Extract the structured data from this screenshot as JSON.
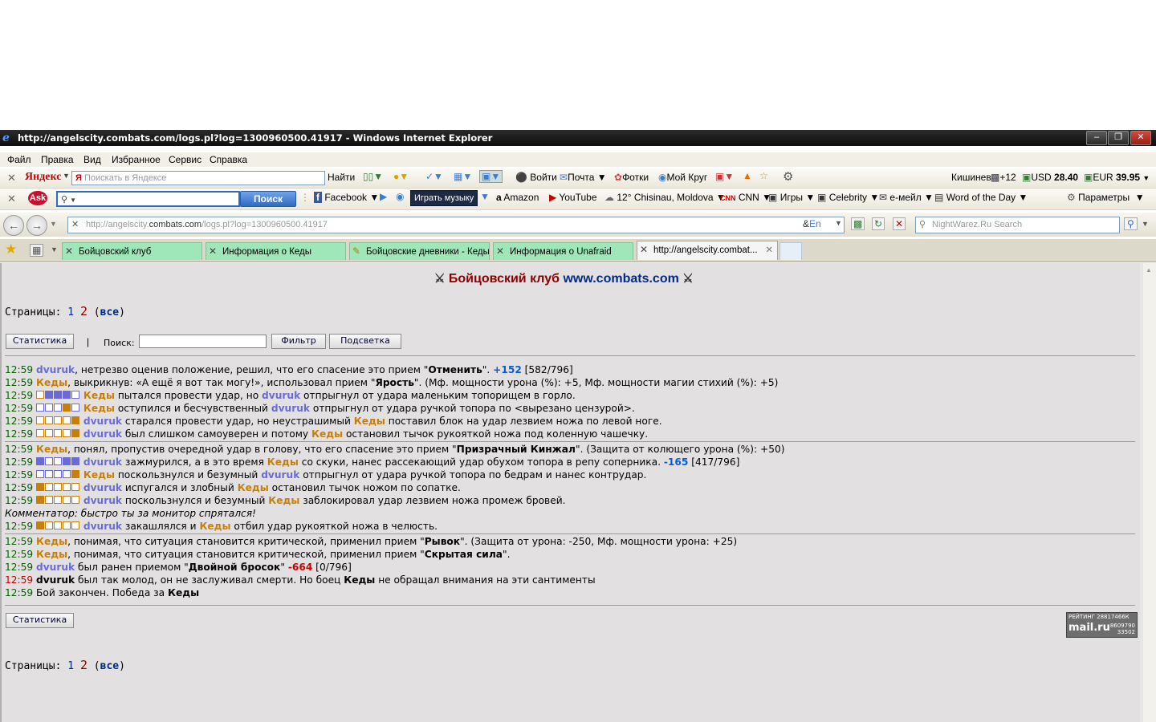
{
  "window": {
    "title": "http://angelscity.combats.com/logs.pl?log=1300960500.41917 - Windows Internet Explorer"
  },
  "menu": [
    "Файл",
    "Правка",
    "Вид",
    "Избранное",
    "Сервис",
    "Справка"
  ],
  "yandex": {
    "logo": "Яндекс",
    "search_placeholder": "Поискать в Яндексе",
    "find": "Найти",
    "login": "Войти",
    "mail": "Почта",
    "photos": "Фотки",
    "circle": "Мой Круг",
    "city": "Кишинев",
    "temp": "+12",
    "usd_label": "USD",
    "usd": "28.40",
    "eur_label": "EUR",
    "eur": "39.95"
  },
  "ask": {
    "logo": "Ask",
    "search": "Поиск",
    "facebook": "Facebook",
    "music": "Играть музыку",
    "amazon": "Amazon",
    "youtube": "YouTube",
    "weather": "12° Chisinau, Moldova",
    "cnn": "CNN",
    "games": "Игры",
    "celebrity": "Celebrity",
    "email": "e-мейл",
    "word": "Word of the Day",
    "params": "Параметры"
  },
  "address": {
    "prefix": "http://angelscity.",
    "domain": "combats.com",
    "path": "/logs.pl?log=1300960500.41917",
    "search_placeholder": "NightWarez.Ru Search"
  },
  "tabs": [
    {
      "label": "Бойцовский клуб"
    },
    {
      "label": "Информация о Кеды"
    },
    {
      "label": "Бойцовские дневники - Кеды"
    },
    {
      "label": "Информация о Unafraid"
    },
    {
      "label": "http://angelscity.combat..."
    }
  ],
  "page": {
    "title_club": "Бойцовский клуб",
    "title_site": "www.combats.com",
    "pages_label": "Страницы:",
    "page1": "1",
    "page2": "2",
    "page_all": "все",
    "stats_btn": "Статистика",
    "sep": "|",
    "search_label": "Поиск:",
    "filter_btn": "Фильтр",
    "highlight_btn": "Подсветка",
    "rating_text": "РЕЙТИНГ 28817466К",
    "rating_brand": "mail.ru",
    "rating_n1": "8609790",
    "rating_n2": "33502"
  },
  "log": {
    "time": "12:59",
    "p1": "dvuruk",
    "p2": "Кеды",
    "l1a": ", нетрезво оценив положение, решил, что его спасение это прием \"",
    "l1b": "Отменить",
    "l1c": "\". ",
    "l1d": "+152",
    "l1e": " [582/796]",
    "l2a": ", выкрикнув: «А ещё я вот так могу!», использовал прием \"",
    "l2b": "Ярость",
    "l2c": "\". (Мф. мощности урона (%): +5, Мф. мощности магии стихий (%): +5)",
    "l3a": " пытался провести удар, но ",
    "l3b": " отпрыгнул от удара маленьким топорищем в горло.",
    "l4a": " оступился и бесчувственный ",
    "l4b": " отпрыгнул от удара ручкой топора по <вырезано цензурой>.",
    "l5a": " старался провести удар, но неустрашимый ",
    "l5b": " поставил блок на удар лезвием ножа по левой ноге.",
    "l6a": " был слишком самоуверен и потому ",
    "l6b": " остановил тычок рукояткой ножа под коленную чашечку.",
    "l7a": ", понял, пропустив очередной удар в голову, что его спасение это прием \"",
    "l7b": "Призрачный Кинжал",
    "l7c": "\". (Защита от колющего урона (%): +50)",
    "l8a": " зажмурился, а в это время ",
    "l8b": " со скуки, нанес рассекающий удар обухом топора в репу соперника. ",
    "l8c": "-165",
    "l8d": " [417/796]",
    "l9a": " поскользнулся и безумный ",
    "l9b": " отпрыгнул от удара ручкой топора по бедрам и нанес контрудар.",
    "l10a": " испугался и злобный ",
    "l10b": " остановил тычок ножом по сопатке.",
    "l11a": " поскользнулся и безумный ",
    "l11b": " заблокировал удар лезвием ножа промеж бровей.",
    "comment": "Комментатор: быстро ты за монитор спрятался!",
    "l12a": " закашлялся и ",
    "l12b": " отбил удар рукояткой ножа в челюсть.",
    "l13a": ", понимая, что ситуация становится критической, применил прием \"",
    "l13b": "Рывок",
    "l13c": "\". (Защита от урона: -250, Мф. мощности урона: +25)",
    "l14a": ", понимая, что ситуация становится критической, применил прием \"",
    "l14b": "Скрытая сила",
    "l14c": "\".",
    "l15a": " был ранен приемом \"",
    "l15b": "Двойной бросок",
    "l15c": "\" ",
    "l15d": "-664",
    "l15e": " [0/796]",
    "l16a": " был так молод, он не заслуживал смерти. Но боец ",
    "l16b": " не обращал внимания на эти сантименты",
    "l17a": " Бой закончен. Победа за "
  }
}
